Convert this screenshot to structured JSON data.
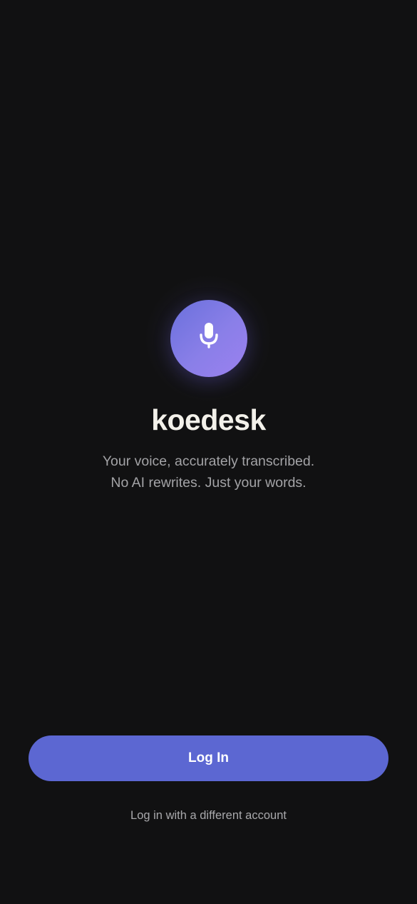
{
  "app": {
    "name": "koedesk",
    "tagline_line1": "Your voice, accurately transcribed.",
    "tagline_line2": "No AI rewrites. Just your words.",
    "logo_icon": "microphone-icon"
  },
  "actions": {
    "login_label": "Log In",
    "alt_login_label": "Log in with a different account"
  },
  "colors": {
    "background": "#111112",
    "accent": "#5c67d2",
    "logo_gradient_start": "#6a70dc",
    "logo_gradient_end": "#9b80f0",
    "title": "#f3f1ea",
    "secondary_text": "#a3a3a6"
  }
}
